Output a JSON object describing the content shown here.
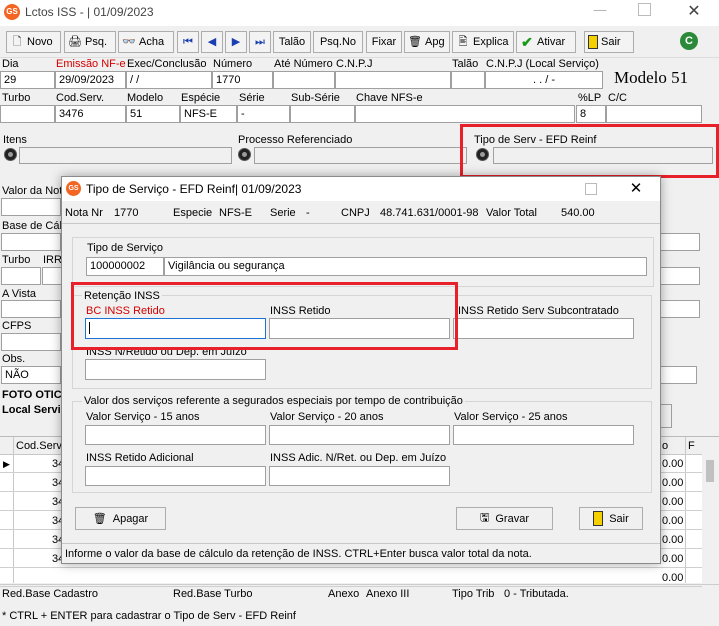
{
  "main_window": {
    "app_icon": "GS",
    "title": "Lctos ISS - |  01/09/2023",
    "toolbar": [
      {
        "icon": "new-icon",
        "label": "Novo"
      },
      {
        "icon": "search-icon",
        "label": "Psq."
      },
      {
        "icon": "binoculars-icon",
        "label": "Acha"
      },
      {
        "icon": "first-icon",
        "label": "⏮"
      },
      {
        "icon": "prev-icon",
        "label": "◀"
      },
      {
        "icon": "next-icon",
        "label": "▶"
      },
      {
        "icon": "last-icon",
        "label": "⏭"
      },
      {
        "icon": "",
        "label": "Talão"
      },
      {
        "icon": "",
        "label": "Psq.No"
      },
      {
        "icon": "",
        "label": "Fixar"
      },
      {
        "icon": "trash-icon",
        "label": "Apg"
      },
      {
        "icon": "explain-icon",
        "label": "Explica"
      },
      {
        "icon": "check-icon",
        "label": "Ativar"
      },
      {
        "icon": "exit-icon",
        "label": "Sair"
      }
    ],
    "labels": {
      "dia": "Dia",
      "emissao": "Emissão NF-e",
      "exec": "Exec/Conclusão",
      "numero": "Número",
      "ate_numero": "Até Número",
      "cnpj": "C.N.P.J",
      "talao": "Talão",
      "cnpj_local": "C.N.P.J (Local Serviço)",
      "modelo_header": "Modelo 51",
      "turbo": "Turbo",
      "cod_serv": "Cod.Serv.",
      "modelo": "Modelo",
      "especie": "Espécie",
      "serie": "Série",
      "sub_serie": "Sub-Série",
      "chave": "Chave NFS-e",
      "lp": "%LP",
      "cc": "C/C",
      "itens": "Itens",
      "processo": "Processo Referenciado",
      "tipo_serv": "Tipo de Serv - EFD Reinf",
      "valor_nota": "Valor da Not",
      "base_calc": "Base de Cálc",
      "turbo2": "Turbo",
      "irrf": "IRR",
      "a_vista": "A Vista",
      "cfps": "CFPS",
      "obs": "Obs.",
      "foto": "FOTO OTICA",
      "local_serv": "Local Servi"
    },
    "values": {
      "dia": "29",
      "emissao": "29/09/2023",
      "exec": " / /",
      "numero": "1770",
      "cnpj_local": ". . / -",
      "cod_serv": "3476",
      "modelo": "51",
      "especie": "NFS-E",
      "serie": "-",
      "lp": "8",
      "obs": "NÃO"
    },
    "grid": {
      "header_cod": "Cod.Servi",
      "rows_cod": [
        "34",
        "34",
        "34",
        "34",
        "34",
        "34"
      ],
      "right_header": "o",
      "right_header2": "F",
      "right_values": [
        "0.00",
        "0.00",
        "0.00",
        "0.00",
        "0.00",
        "0.00",
        "0.00"
      ]
    },
    "status_bar": {
      "red_base_cadastro": "Red.Base Cadastro",
      "red_base_turbo": "Red.Base Turbo",
      "anexo": "Anexo",
      "anexo_value": "Anexo III",
      "tipo_trib": "Tipo Trib",
      "tipo_trib_value": "0  - Tributada."
    },
    "footer_hint": "* CTRL + ENTER para  cadastrar o Tipo de Serv - EFD Reinf"
  },
  "dialog": {
    "app_icon": "GS",
    "title": "Tipo de Serviço - EFD Reinf|  01/09/2023",
    "info": {
      "nota_label": "Nota Nr",
      "nota": "1770",
      "especie_label": "Especie",
      "especie": "NFS-E",
      "serie_label": "Serie",
      "serie": "-",
      "cnpj_label": "CNPJ",
      "cnpj": "48.741.631/0001-98",
      "valor_label": "Valor Total",
      "valor": "540.00"
    },
    "tipo_servico_label": "Tipo de Serviço",
    "tipo_servico_code": "100000002",
    "tipo_servico_desc": "Vigilância ou segurança",
    "retencao_title": "Retenção INSS",
    "bc_inss_retido": "BC INSS Retido",
    "inss_retido": "INSS Retido",
    "inss_retido_sub": "INSS Retido Serv Subcontratado",
    "inss_nao_retido": "INSS N/Retido ou Dep. em Juízo",
    "especiais_title": "Valor dos serviços referente a segurados especiais por tempo de contribuição",
    "valor15": "Valor Serviço - 15 anos",
    "valor20": "Valor Serviço - 20 anos",
    "valor25": "Valor Serviço - 25 anos",
    "inss_adicional": "INSS Retido Adicional",
    "inss_adic_nret": "INSS Adic. N/Ret. ou Dep. em Juízo",
    "buttons": {
      "apagar": "Apagar",
      "gravar": "Gravar",
      "sair": "Sair"
    },
    "status": "Informe o valor da base de cálculo da retenção de INSS. CTRL+Enter busca valor total da nota."
  },
  "colors": {
    "highlight": "#e8202a",
    "required_label": "#d40000",
    "accent": "#f26522"
  }
}
